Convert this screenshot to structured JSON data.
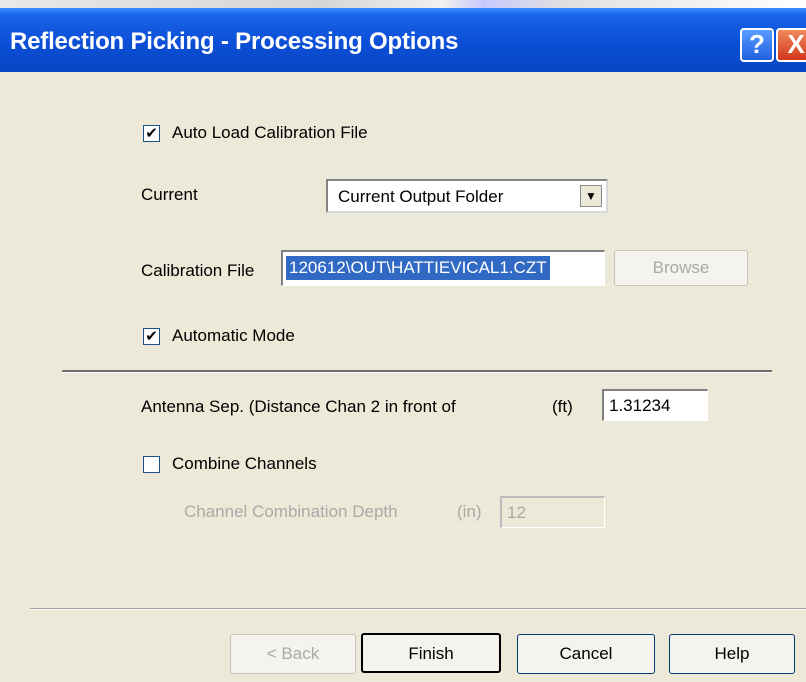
{
  "window": {
    "title": "Reflection Picking - Processing Options",
    "help_glyph": "?",
    "close_glyph": "X"
  },
  "options": {
    "auto_load_label": "Auto Load Calibration File",
    "auto_load_checked": true,
    "current_label": "Current",
    "current_value": "Current Output Folder",
    "calibration_label": "Calibration File",
    "calibration_value": "120612\\OUT\\HATTIEVICAL1.CZT",
    "browse_label": "Browse",
    "automatic_mode_label": "Automatic Mode",
    "automatic_mode_checked": true,
    "antenna_label": "Antenna Sep. (Distance Chan 2 in front of",
    "antenna_unit": "(ft)",
    "antenna_value": "1.31234",
    "combine_label": "Combine Channels",
    "combine_checked": false,
    "depth_label": "Channel Combination Depth",
    "depth_unit": "(in)",
    "depth_value": "12"
  },
  "buttons": {
    "back": "< Back",
    "finish": "Finish",
    "cancel": "Cancel",
    "help": "Help"
  },
  "check_glyph": "✔"
}
